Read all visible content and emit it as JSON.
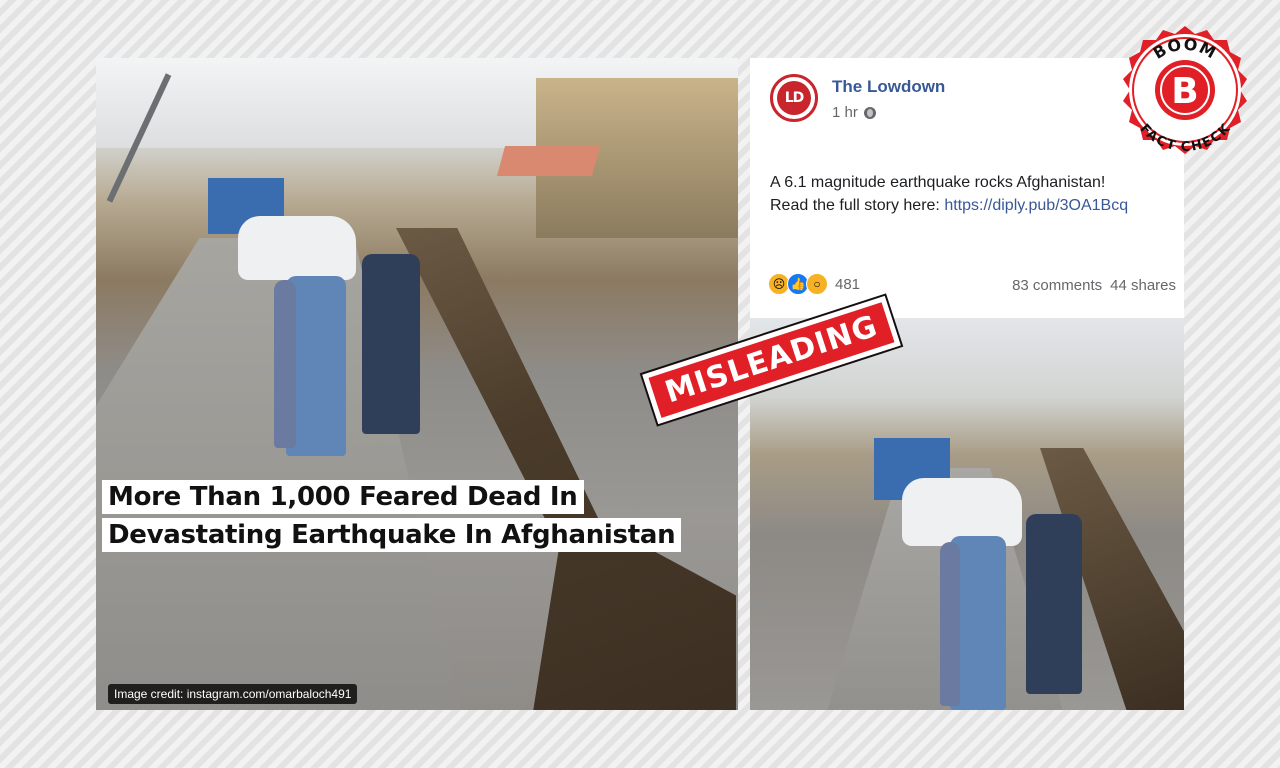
{
  "left_image": {
    "headline_line1": "More Than 1,000 Feared Dead In",
    "headline_line2": "Devastating Earthquake In Afghanistan",
    "credit": "Image credit: instagram.com/omarbaloch491"
  },
  "post": {
    "page_name": "The Lowdown",
    "avatar_initials": "LD",
    "time": "1 hr",
    "privacy_icon": "globe-icon",
    "text_line1": "A 6.1 magnitude earthquake rocks Afghanistan!",
    "text_line2_prefix": "Read the full story here: ",
    "link": "https://diply.pub/3OA1Bcq",
    "reactions": [
      "sad",
      "like",
      "wow"
    ],
    "reaction_count": "481",
    "comments": "83 comments",
    "shares": "44 shares"
  },
  "stamp": {
    "label": "MISLEADING",
    "color": "#e01f26"
  },
  "badge": {
    "top": "BOOM",
    "letter": "B",
    "bottom": "FACT CHECK",
    "color": "#e01f26"
  },
  "colors": {
    "link": "#385898",
    "accent": "#e01f26"
  }
}
